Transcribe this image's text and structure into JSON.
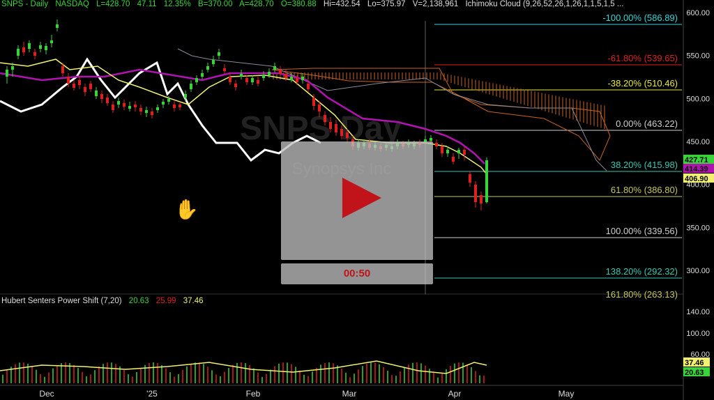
{
  "header": {
    "symbol": "SNPS - Daily",
    "exchange": "NASDAQ",
    "last": "L=428.70",
    "change": "47.11",
    "change_pct": "12.35%",
    "bid": "B=370.00",
    "ask": "A=428.70",
    "open": "O=380.88",
    "high": "Hi=432.54",
    "low": "Lo=375.97",
    "volume": "V=2,138,961",
    "indicator": "Ichimoku Cloud (9,26,52,26,1,26,1,1,5,1,5 ..."
  },
  "watermark": {
    "line1": "SNPS Day",
    "line2": "Synopsys Inc"
  },
  "price_axis": [
    "600.00",
    "550.00",
    "500.00",
    "450.00",
    "400.00",
    "350.00",
    "300.00"
  ],
  "price_tags": [
    {
      "text": "427.71",
      "color": "#39d439",
      "text_color": "#000"
    },
    {
      "text": "414.39",
      "color": "#b013b0",
      "text_color": "#000"
    },
    {
      "text": "406.90",
      "color": "#f2f270",
      "text_color": "#000"
    }
  ],
  "fib_levels": [
    {
      "label": "-100.00% (586.89)",
      "color": "#37d7d7"
    },
    {
      "label": "-61.80% (539.65)",
      "color": "#e02020"
    },
    {
      "label": "-38.20% (510.46)",
      "color": "#eaea3a"
    },
    {
      "label": "0.00% (463.22)",
      "color": "#cfcfcf"
    },
    {
      "label": "38.20% (415.98)",
      "color": "#37c8b4"
    },
    {
      "label": "61.80% (386.80)",
      "color": "#c8c85a"
    },
    {
      "label": "100.00% (339.56)",
      "color": "#cfcfcf"
    },
    {
      "label": "138.20% (292.32)",
      "color": "#37c8b4"
    },
    {
      "label": "161.80% (263.13)",
      "color": "#c8c85a"
    }
  ],
  "x_axis": [
    "Dec",
    "'25",
    "Feb",
    "Mar",
    "Apr",
    "May"
  ],
  "sub_indicator": {
    "name": "Hubert Senters Power Shift (7,20)",
    "v1": "20.63",
    "v2": "25.99",
    "v3": "37.46",
    "axis": [
      "140.00",
      "100.00",
      "60.00"
    ],
    "tags": [
      {
        "text": "37.46",
        "color": "#f2f270"
      },
      {
        "text": "20.63",
        "color": "#39d439"
      }
    ]
  },
  "video": {
    "timer": "00:50",
    "play_color": "#c0141a"
  },
  "colors": {
    "up_candle": "#39d439",
    "down_candle": "#e02020",
    "kijun": "#b013b0",
    "tenkan": "#f2f270",
    "lagging": "#ffffff",
    "cloud": "#c86420"
  }
}
